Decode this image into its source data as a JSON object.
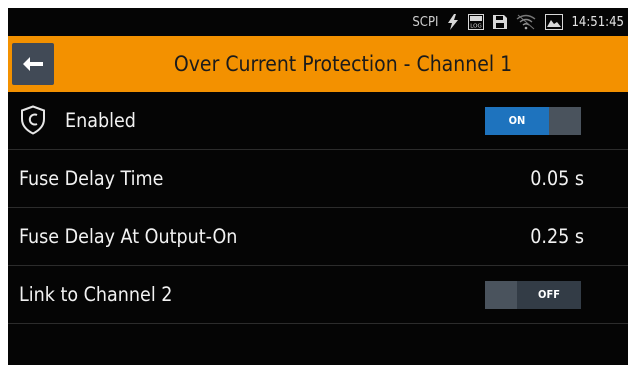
{
  "status": {
    "scpi": "SCPI",
    "log": "LOG",
    "time": "14:51:45"
  },
  "header": {
    "title": "Over Current Protection - Channel 1"
  },
  "rows": [
    {
      "label": "Enabled",
      "toggle": "ON",
      "state": true
    },
    {
      "label": "Fuse Delay Time",
      "value": "0.05 s"
    },
    {
      "label": "Fuse Delay At Output-On",
      "value": "0.25 s"
    },
    {
      "label": "Link to Channel 2",
      "toggle": "OFF",
      "state": false
    }
  ],
  "icons": [
    "lightning-icon",
    "log-icon",
    "save-icon",
    "wifi-icon",
    "card-icon",
    "back-arrow-icon",
    "shield-icon"
  ],
  "colors": {
    "header": "#f39100",
    "accent": "#1e73be",
    "background": "#050505"
  }
}
